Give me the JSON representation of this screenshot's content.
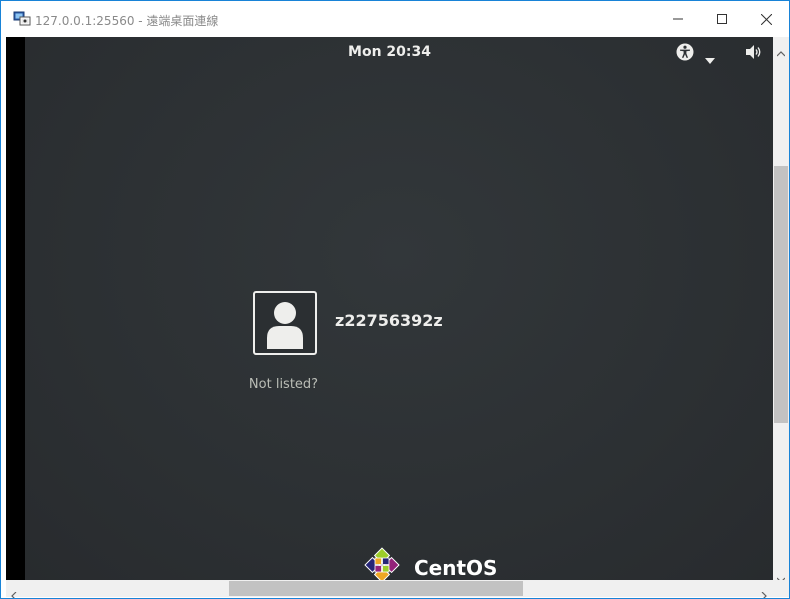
{
  "window": {
    "title": "127.0.0.1:25560 - 遠端桌面連線",
    "app_icon": "remote-desktop-icon",
    "controls": {
      "minimize_icon": "minimize-icon",
      "maximize_icon": "maximize-icon",
      "close_icon": "close-icon"
    }
  },
  "remote_session": {
    "top_bar": {
      "clock": "Mon 20:34",
      "accessibility_icon": "accessibility-icon",
      "menu_arrow_icon": "chevron-down-icon",
      "volume_icon": "volume-icon"
    },
    "login": {
      "avatar_icon": "user-avatar-icon",
      "username": "z22756392z",
      "not_listed": "Not listed?"
    },
    "branding": {
      "logo_icon": "centos-logo-icon",
      "name": "CentOS"
    }
  },
  "colors": {
    "window_border": "#1883d7",
    "desktop_background": "#2d3134",
    "text_primary": "#eeeeec",
    "text_secondary": "#babdb6",
    "scrollbar_thumb": "#c2c2c2"
  }
}
